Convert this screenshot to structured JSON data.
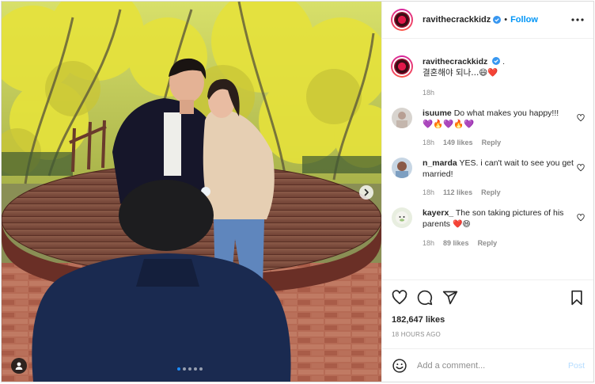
{
  "post": {
    "username": "ravithecrackkidz",
    "follow_label": "Follow",
    "separator": "•",
    "verified": true
  },
  "caption": {
    "username": "ravithecrackkidz",
    "text": ".",
    "text2": "결혼해야 되나...😄❤️",
    "time": "18h"
  },
  "comments": [
    {
      "username": "isuume",
      "text": "Do what makes you happy!!!",
      "emojis": "💜🔥💜🔥💜",
      "time": "18h",
      "likes": "149 likes",
      "reply": "Reply"
    },
    {
      "username": "n_marda",
      "text": "YES. i can't wait to see you get married!",
      "time": "18h",
      "likes": "112 likes",
      "reply": "Reply"
    },
    {
      "username": "kayerx_",
      "text": "The son taking pictures of his parents",
      "emojis": "❤️😄",
      "time": "18h",
      "likes": "89 likes",
      "reply": "Reply"
    }
  ],
  "stats": {
    "likes": "182,647 likes",
    "timestamp": "18 HOURS AGO"
  },
  "composer": {
    "placeholder": "Add a comment...",
    "post_label": "Post"
  },
  "carousel": {
    "total": 5,
    "current": 1
  },
  "colors": {
    "accent": "#0095f6",
    "post_disabled": "#b3dbff",
    "muted": "#8e8e8e",
    "heart": "#ed4956",
    "carousel_active": "#1a8cff"
  },
  "icons": [
    "more-icon",
    "heart-icon",
    "comment-icon",
    "share-icon",
    "save-icon",
    "emoji-icon",
    "next-arrow-icon",
    "tag-user-icon",
    "verified-icon"
  ]
}
